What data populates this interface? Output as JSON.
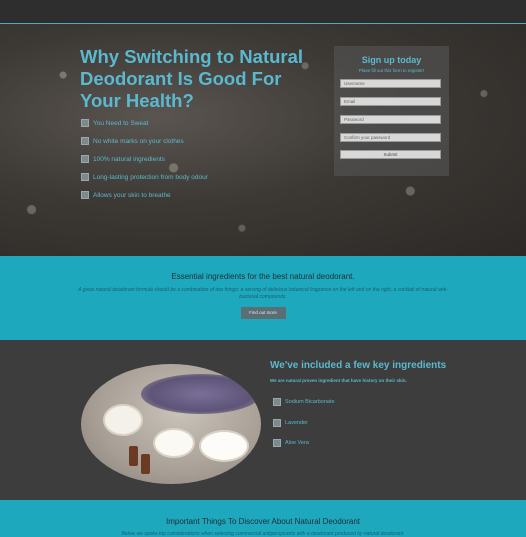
{
  "hero": {
    "title_part1": "Why Switching to ",
    "title_bold": "Natural Deodorant",
    "title_part2": " Is Good For Your Health?",
    "benefits": [
      "You Need to Sweat",
      "No white marks on your clothes",
      "100% natural ingredients",
      "Long-lasting protection from body odour",
      "Allows your skin to breathe"
    ]
  },
  "signup": {
    "title": "Sign up today",
    "subtitle": "Plase fill out this form to register!",
    "username_placeholder": "Username",
    "email_placeholder": "Email",
    "password_placeholder": "Password",
    "confirm_placeholder": "Confirm your password",
    "submit_label": "Submit"
  },
  "essential": {
    "title": "Essential ingredients for the best natural deodorant.",
    "text": "A great natural deodorant formula should be a combination of two things: a serving of delicious botanical fragrance on the left and on the right, a cocktail of natural anti-bacterial compounds.",
    "button": "Find out more"
  },
  "ingredients": {
    "title": "We've included a few key ingredients",
    "subtitle": "We are natural proven ingredient that have history on their skin.",
    "items": [
      "Sodium Bicarbonate",
      "Lavender",
      "Aloe Vera"
    ]
  },
  "important": {
    "title": "Important Things To Discover About Natural Deodorant",
    "text": "Below we spoke top considerations when selecting commercial antiperspirants with a deodorant produced by natural deodorant."
  }
}
